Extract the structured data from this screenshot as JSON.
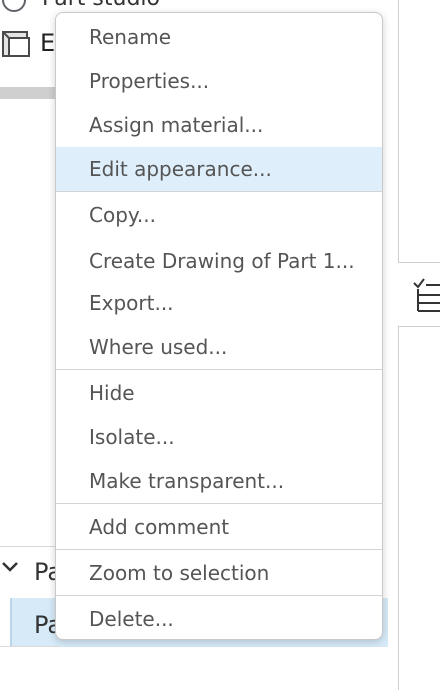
{
  "background": {
    "tree_top_text": "Part studio",
    "part_row_letter": "E",
    "parts_section_label": "Pa",
    "selected_part_label": "Pa"
  },
  "context_menu": {
    "items": [
      {
        "label": "Rename"
      },
      {
        "label": "Properties..."
      },
      {
        "label": "Assign material..."
      },
      {
        "label": "Edit appearance..."
      },
      {
        "label": "Copy..."
      },
      {
        "label": "Create Drawing of Part 1..."
      },
      {
        "label": "Export..."
      },
      {
        "label": "Where used..."
      },
      {
        "label": "Hide"
      },
      {
        "label": "Isolate..."
      },
      {
        "label": "Make transparent..."
      },
      {
        "label": "Add comment"
      },
      {
        "label": "Zoom to selection"
      },
      {
        "label": "Delete..."
      }
    ],
    "highlighted_item": "Edit appearance..."
  },
  "colors": {
    "highlight": "#deeefa",
    "selected_row": "#d6eaf8",
    "menu_text": "#555555",
    "border": "#c9c9c9"
  }
}
